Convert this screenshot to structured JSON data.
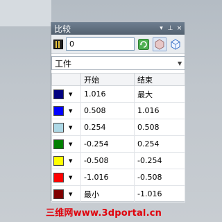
{
  "panel": {
    "title": "比较",
    "pin_glyph": "▾ ⊥",
    "close_glyph": "×"
  },
  "toolbar": {
    "value": "0"
  },
  "dropdown": {
    "selected": "工件"
  },
  "table": {
    "headers": [
      "",
      "开始",
      "结束"
    ],
    "rows": [
      {
        "color": "#000080",
        "start": "1.016",
        "end": "最大"
      },
      {
        "color": "#0000ff",
        "start": "0.508",
        "end": "1.016"
      },
      {
        "color": "#add8e6",
        "start": "0.254",
        "end": "0.508"
      },
      {
        "color": "#008000",
        "start": "-0.254",
        "end": "0.254"
      },
      {
        "color": "#ffff00",
        "start": "-0.508",
        "end": "-0.254"
      },
      {
        "color": "#ff0000",
        "start": "-1.016",
        "end": "-0.508"
      },
      {
        "color": "#800000",
        "start": "最小",
        "end": "-1.016"
      }
    ]
  },
  "watermark": "三维网www.3dportal.cn"
}
